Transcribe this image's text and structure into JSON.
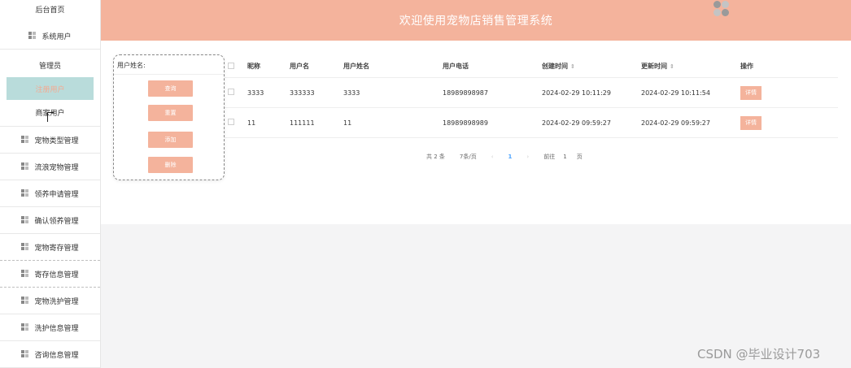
{
  "app": {
    "title": "欢迎使用宠物店销售管理系统"
  },
  "sidebar": {
    "top_label": "后台首页",
    "items": [
      {
        "label": "系统用户"
      },
      {
        "label": "宠物类型管理"
      },
      {
        "label": "流浪宠物管理"
      },
      {
        "label": "领养申请管理"
      },
      {
        "label": "确认领养管理"
      },
      {
        "label": "宠物寄存管理"
      },
      {
        "label": "寄存信息管理"
      },
      {
        "label": "宠物洗护管理"
      },
      {
        "label": "洗护信息管理"
      },
      {
        "label": "咨询信息管理"
      }
    ],
    "submenu": [
      {
        "label": "管理员"
      },
      {
        "label": "注册用户"
      },
      {
        "label": "商家用户"
      }
    ]
  },
  "search": {
    "label": "用户姓名:",
    "buttons": {
      "query": "查询",
      "reset": "重置",
      "add": "添加",
      "delete": "删除"
    }
  },
  "table": {
    "headers": {
      "nickname": "昵称",
      "username": "用户名",
      "name": "用户姓名",
      "phone": "用户电话",
      "created": "创建时间",
      "updated": "更新时间",
      "actions": "操作"
    },
    "rows": [
      {
        "nickname": "3333",
        "username": "333333",
        "name": "3333",
        "phone": "18989898987",
        "created": "2024-02-29 10:11:29",
        "updated": "2024-02-29 10:11:54",
        "action": "详情"
      },
      {
        "nickname": "11",
        "username": "111111",
        "name": "11",
        "phone": "18989898989",
        "created": "2024-02-29 09:59:27",
        "updated": "2024-02-29 09:59:27",
        "action": "详情"
      }
    ]
  },
  "pagination": {
    "total": "共 2 条",
    "page_size": "7条/页",
    "prev": "‹",
    "current": "1",
    "next": "›",
    "goto_label": "前往",
    "goto_value": "1",
    "page_unit": "页"
  },
  "watermark": "CSDN @毕业设计703",
  "colors": {
    "accent": "#f4b39c",
    "active_bg": "#b9dcdb",
    "active_text": "#f5a88f"
  }
}
